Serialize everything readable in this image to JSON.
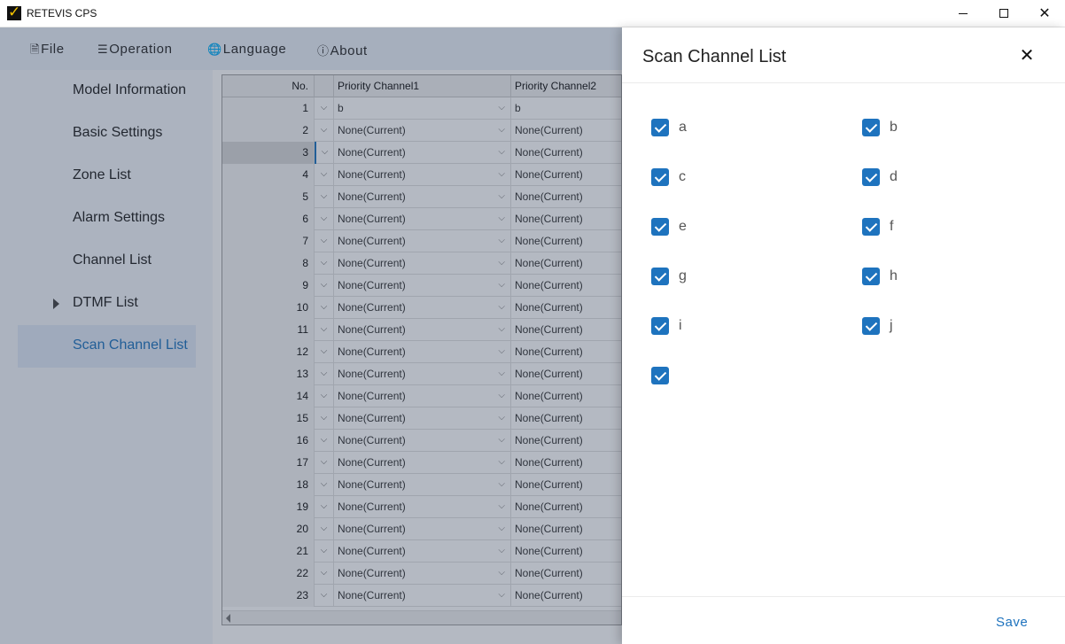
{
  "window": {
    "title": "RETEVIS CPS",
    "minimize_icon": "minimize-icon",
    "maximize_icon": "maximize-icon",
    "close_glyph": "✕"
  },
  "menu": {
    "items": [
      {
        "label": "File",
        "icon": "file-icon",
        "glyph": "🗎"
      },
      {
        "label": "Operation",
        "icon": "operation-icon",
        "glyph": "☰"
      },
      {
        "label": "Language",
        "icon": "globe-icon",
        "glyph": "🌐"
      },
      {
        "label": "About",
        "icon": "info-icon",
        "glyph": "ⓘ"
      }
    ]
  },
  "sidebar": {
    "items": [
      {
        "label": "Model Information"
      },
      {
        "label": "Basic Settings"
      },
      {
        "label": "Zone List"
      },
      {
        "label": "Alarm Settings"
      },
      {
        "label": "Channel List"
      },
      {
        "label": "DTMF List",
        "expandable": true
      },
      {
        "label": "Scan Channel List",
        "active": true
      }
    ]
  },
  "grid": {
    "columns": [
      "No.",
      "Priority Channel1",
      "Priority Channel2"
    ],
    "current_row": 3,
    "rows": [
      {
        "no": "1",
        "p1": "b",
        "p2": "b"
      },
      {
        "no": "2",
        "p1": "None(Current)",
        "p2": "None(Current)"
      },
      {
        "no": "3",
        "p1": "None(Current)",
        "p2": "None(Current)"
      },
      {
        "no": "4",
        "p1": "None(Current)",
        "p2": "None(Current)"
      },
      {
        "no": "5",
        "p1": "None(Current)",
        "p2": "None(Current)"
      },
      {
        "no": "6",
        "p1": "None(Current)",
        "p2": "None(Current)"
      },
      {
        "no": "7",
        "p1": "None(Current)",
        "p2": "None(Current)"
      },
      {
        "no": "8",
        "p1": "None(Current)",
        "p2": "None(Current)"
      },
      {
        "no": "9",
        "p1": "None(Current)",
        "p2": "None(Current)"
      },
      {
        "no": "10",
        "p1": "None(Current)",
        "p2": "None(Current)"
      },
      {
        "no": "11",
        "p1": "None(Current)",
        "p2": "None(Current)"
      },
      {
        "no": "12",
        "p1": "None(Current)",
        "p2": "None(Current)"
      },
      {
        "no": "13",
        "p1": "None(Current)",
        "p2": "None(Current)"
      },
      {
        "no": "14",
        "p1": "None(Current)",
        "p2": "None(Current)"
      },
      {
        "no": "15",
        "p1": "None(Current)",
        "p2": "None(Current)"
      },
      {
        "no": "16",
        "p1": "None(Current)",
        "p2": "None(Current)"
      },
      {
        "no": "17",
        "p1": "None(Current)",
        "p2": "None(Current)"
      },
      {
        "no": "18",
        "p1": "None(Current)",
        "p2": "None(Current)"
      },
      {
        "no": "19",
        "p1": "None(Current)",
        "p2": "None(Current)"
      },
      {
        "no": "20",
        "p1": "None(Current)",
        "p2": "None(Current)"
      },
      {
        "no": "21",
        "p1": "None(Current)",
        "p2": "None(Current)"
      },
      {
        "no": "22",
        "p1": "None(Current)",
        "p2": "None(Current)"
      },
      {
        "no": "23",
        "p1": "None(Current)",
        "p2": "None(Current)"
      }
    ]
  },
  "drawer": {
    "title": "Scan Channel List",
    "close_glyph": "✕",
    "checkboxes": [
      {
        "label": "a",
        "checked": true
      },
      {
        "label": "b",
        "checked": true
      },
      {
        "label": "c",
        "checked": true
      },
      {
        "label": "d",
        "checked": true
      },
      {
        "label": "e",
        "checked": true
      },
      {
        "label": "f",
        "checked": true
      },
      {
        "label": "g",
        "checked": true
      },
      {
        "label": "h",
        "checked": true
      },
      {
        "label": "i",
        "checked": true
      },
      {
        "label": "j",
        "checked": true
      },
      {
        "label": "",
        "checked": true
      }
    ],
    "save_label": "Save"
  },
  "colors": {
    "accent": "#1e73be",
    "overlay": "rgba(40,55,80,0.35)"
  }
}
